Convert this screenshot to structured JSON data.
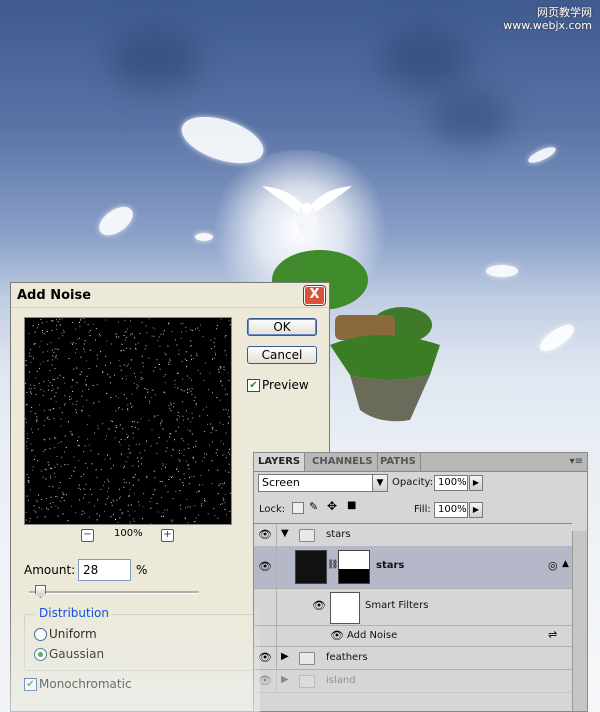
{
  "watermark": {
    "line1": "网页教学网",
    "line2": "www.webjx.com"
  },
  "dialog": {
    "title": "Add Noise",
    "close_label": "X",
    "ok_label": "OK",
    "cancel_label": "Cancel",
    "preview_label": "Preview",
    "preview_checked": true,
    "zoom_minus": "−",
    "zoom_level": "100%",
    "zoom_plus": "+",
    "amount_label": "Amount:",
    "amount_value": "28",
    "amount_unit": "%",
    "distribution_label": "Distribution",
    "uniform_label": "Uniform",
    "gaussian_label": "Gaussian",
    "distribution_selected": "Gaussian",
    "monochromatic_label": "Monochromatic",
    "monochromatic_checked": true
  },
  "layers_panel": {
    "tabs": [
      "LAYERS",
      "CHANNELS",
      "PATHS"
    ],
    "active_tab": "LAYERS",
    "blend_mode": "Screen",
    "opacity_label": "Opacity:",
    "opacity_value": "100%",
    "lock_label": "Lock:",
    "fill_label": "Fill:",
    "fill_value": "100%",
    "rows": {
      "group_stars": "stars",
      "layer_stars": "stars",
      "smart_filters": "Smart Filters",
      "add_noise": "Add Noise",
      "group_feathers": "feathers",
      "group_island": "island"
    }
  },
  "colors": {
    "sky_top": "#3f5a8f",
    "dialog_bg": "#ece9d8",
    "panel_bg": "#d6d6d6",
    "accent_blue": "#0046d5",
    "close_red": "#d9523a"
  }
}
